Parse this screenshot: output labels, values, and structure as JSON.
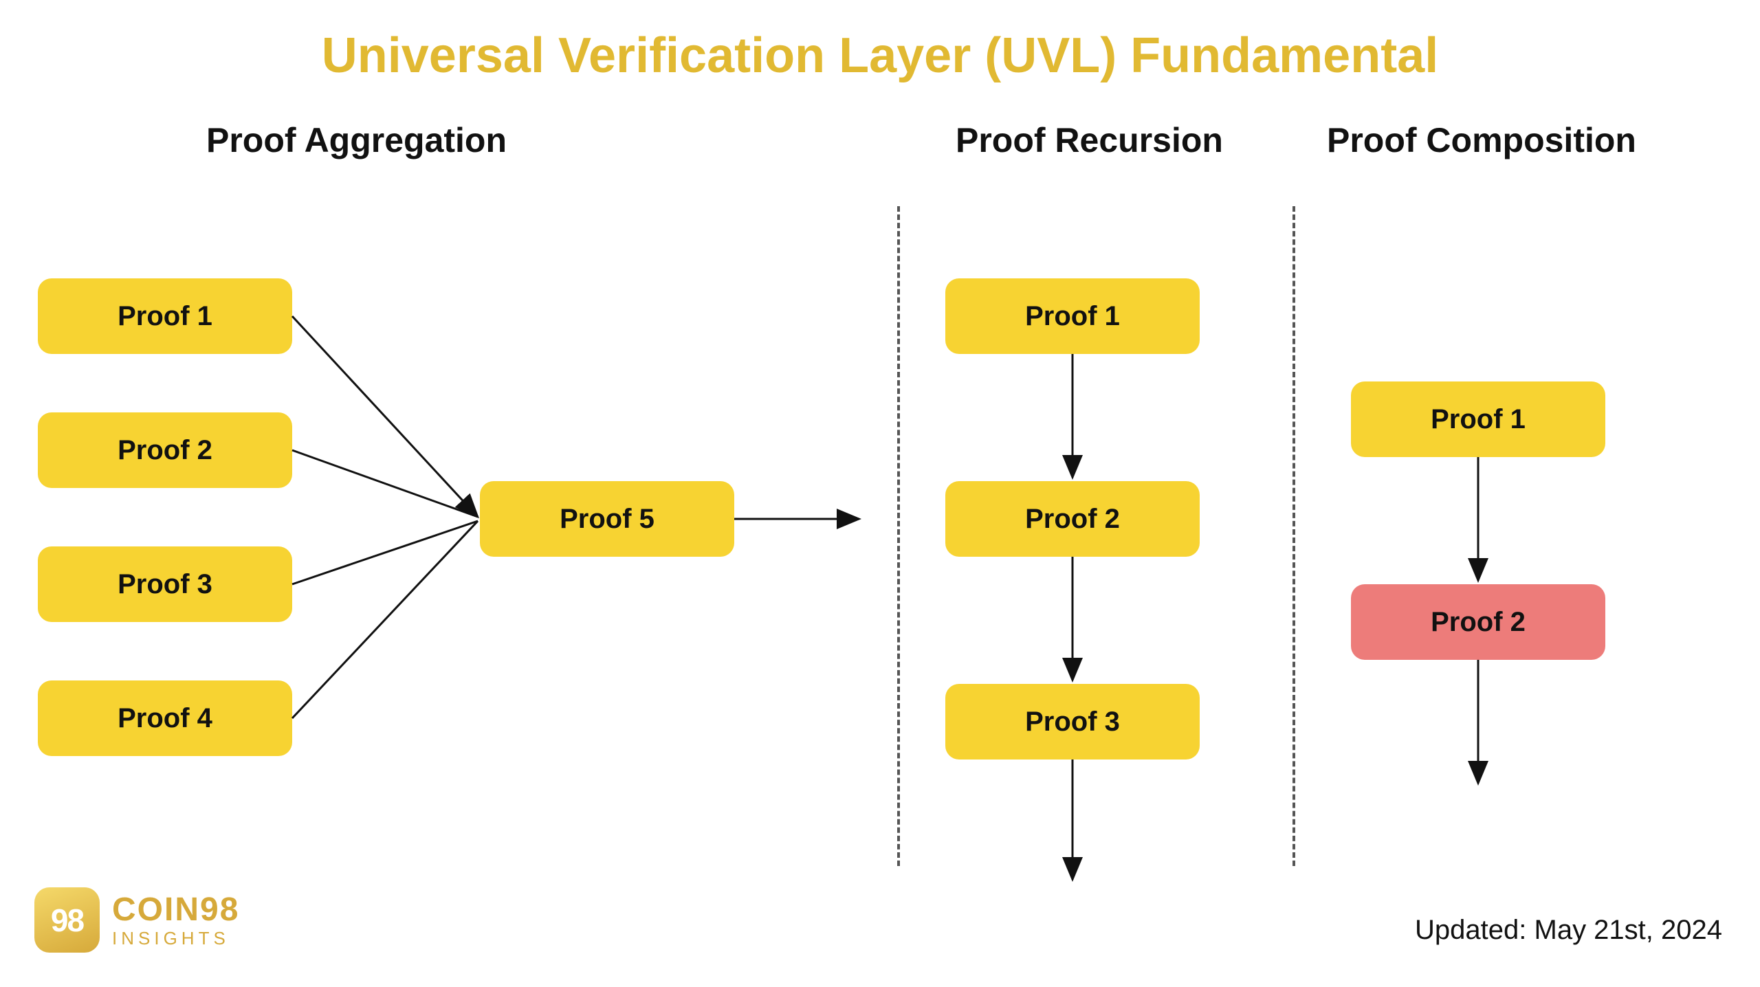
{
  "title": "Universal Verification Layer (UVL) Fundamental",
  "sections": {
    "aggregation": {
      "label": "Proof Aggregation",
      "inputs": [
        "Proof 1",
        "Proof 2",
        "Proof 3",
        "Proof 4"
      ],
      "output": "Proof 5"
    },
    "recursion": {
      "label": "Proof Recursion",
      "steps": [
        "Proof 1",
        "Proof 2",
        "Proof 3"
      ]
    },
    "composition": {
      "label": "Proof Composition",
      "steps": [
        {
          "label": "Proof 1",
          "variant": "yellow"
        },
        {
          "label": "Proof 2",
          "variant": "red"
        }
      ]
    }
  },
  "logo": {
    "mark": "98",
    "brand": "COIN98",
    "sub": "INSIGHTS"
  },
  "updated": "Updated: May 21st, 2024",
  "colors": {
    "accent": "#E1B932",
    "boxYellow": "#F7D332",
    "boxRed": "#ED7C7A"
  }
}
